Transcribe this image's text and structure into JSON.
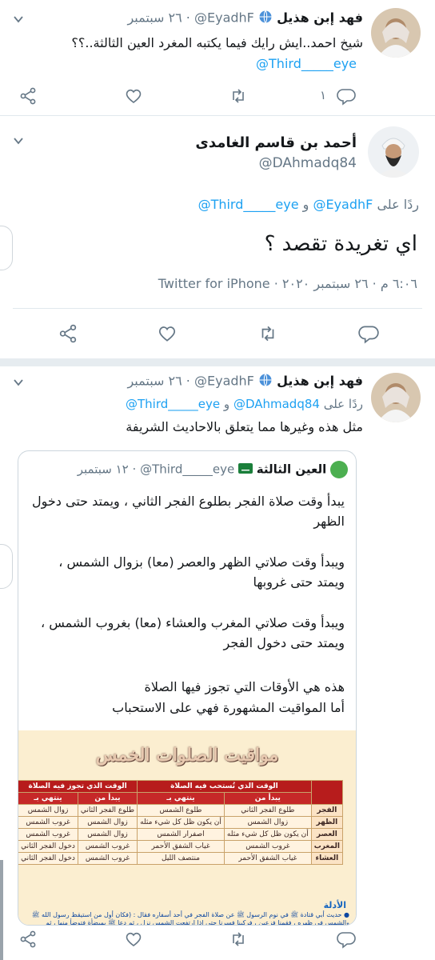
{
  "tweet1": {
    "name": "فهد إبن هذيل",
    "handle": "@EyadhF",
    "time": "· ٢٦ سبتمبر",
    "text": "شيخ احمد..ايش رايك فيما يكتبه المغرد العين الثالثة..؟؟",
    "mention": "@Third_____eye",
    "reply_count": "١"
  },
  "main": {
    "name": "أحمد بن قاسم الغامدى",
    "handle": "@DAhmadq84",
    "reply_prefix": "ردًا على",
    "reply_to_1": "@EyadhF",
    "reply_and": "و",
    "reply_to_2": "@Third_____eye",
    "text": "اي تغريدة تقصد ؟",
    "meta": "٦:٠٦ م · ٢٦ سبتمبر ٢٠٢٠ · Twitter for iPhone"
  },
  "tweet3": {
    "name": "فهد إبن هذيل",
    "handle": "@EyadhF",
    "time": "· ٢٦ سبتمبر",
    "reply_prefix": "ردًا على",
    "reply_to_1": "@DAhmadq84",
    "reply_and": "و",
    "reply_to_2": "@Third_____eye",
    "text": "مثل هذه وغيرها مما يتعلق بالاحاديث الشريفة"
  },
  "quote": {
    "name": "العين الثالثة",
    "handle": "@Third_____eye",
    "time": "· ١٢ سبتمبر",
    "p1": "يبدأ وقت صلاة الفجر بطلوع الفجر الثاني ، ويمتد حتى دخول الظهر",
    "p2": "ويبدأ وقت صلاتي الظهر والعصر (معا) بزوال الشمس ، ويمتد حتى غروبها",
    "p3": "ويبدأ وقت صلاتي المغرب والعشاء (معا) بغروب الشمس ، ويمتد حتى دخول الفجر",
    "p4a": "هذه هي الأوقات التي تجوز فيها الصلاة",
    "p4b": "أما المواقيت المشهورة فهي على الاستحباب"
  },
  "infographic": {
    "title": "مواقيت الصلوات الخمس",
    "group_mustahab": "الوقت الذي تُستحب فيه الصلاة",
    "group_jawaz": "الوقت الذي تجوز فيه الصلاة",
    "col_start": "يبدأ من",
    "col_end": "ينتهي بـ",
    "rows": [
      {
        "prayer": "الفجر",
        "ms": "طلوع الفجر الثاني",
        "me": "طلوع الشمس",
        "js": "طلوع الفجر الثاني",
        "je": "زوال الشمس"
      },
      {
        "prayer": "الظهر",
        "ms": "زوال الشمس",
        "me": "أن يكون ظل كل شيء مثله",
        "js": "زوال الشمس",
        "je": "غروب الشمس"
      },
      {
        "prayer": "العصر",
        "ms": "أن يكون ظل كل شيء مثله",
        "me": "اصفرار الشمس",
        "js": "زوال الشمس",
        "je": "غروب الشمس"
      },
      {
        "prayer": "المغرب",
        "ms": "غروب الشمس",
        "me": "غياب الشفق الأحمر",
        "js": "غروب الشمس",
        "je": "دخول الفجر الثاني"
      },
      {
        "prayer": "العشاء",
        "ms": "غياب الشفق الأحمر",
        "me": "منتصف الليل",
        "js": "غروب الشمس",
        "je": "دخول الفجر الثاني"
      }
    ],
    "evidence_title": "الأدلة",
    "evidence_line1": "● حديث أبي قتادة ﷺ في نوم الرسول ﷺ عن صلاة الفجر في أحد أسفاره فقال : (فكان أول من استيقظ رسول الله ﷺ",
    "evidence_line2": "والشمس في ظهره ، فقمنا فزعين ، فركبنا فسرنا حتى إذا ارتفعت الشمس نزل ، ثم دعا ﷺ بميضأة فتوضأ منها ، ثم"
  },
  "colors": {
    "accent": "#1da1f2",
    "text": "#14171a",
    "muted": "#657786",
    "divider": "#e1e8ed"
  },
  "icons": [
    "share-icon",
    "like-icon",
    "retweet-icon",
    "reply-icon",
    "chevron-down-icon",
    "globe-icon",
    "verified-flag-icon"
  ]
}
